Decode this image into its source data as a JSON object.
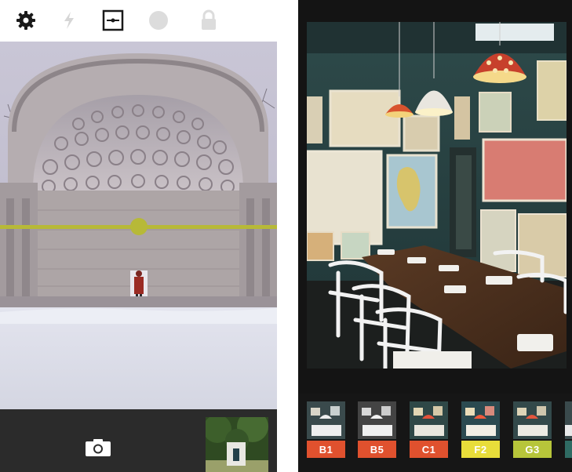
{
  "left_screen": {
    "toolbar": {
      "icons": [
        "gear-icon",
        "flash-icon",
        "level-icon",
        "circle-icon",
        "lock-icon"
      ]
    },
    "viewfinder": {
      "level_line_color": "#b7b938"
    },
    "camera_bar": {
      "shutter_icon": "camera-icon",
      "thumbnail": "last-photo-thumbnail"
    }
  },
  "right_screen": {
    "filters": [
      {
        "label": "B1",
        "color": "#e0512e"
      },
      {
        "label": "B5",
        "color": "#e0512e"
      },
      {
        "label": "C1",
        "color": "#e0512e"
      },
      {
        "label": "F2",
        "color": "#e8dd3a"
      },
      {
        "label": "G3",
        "color": "#b7c53a"
      }
    ],
    "partial_filter_color": "#2f6b63"
  }
}
